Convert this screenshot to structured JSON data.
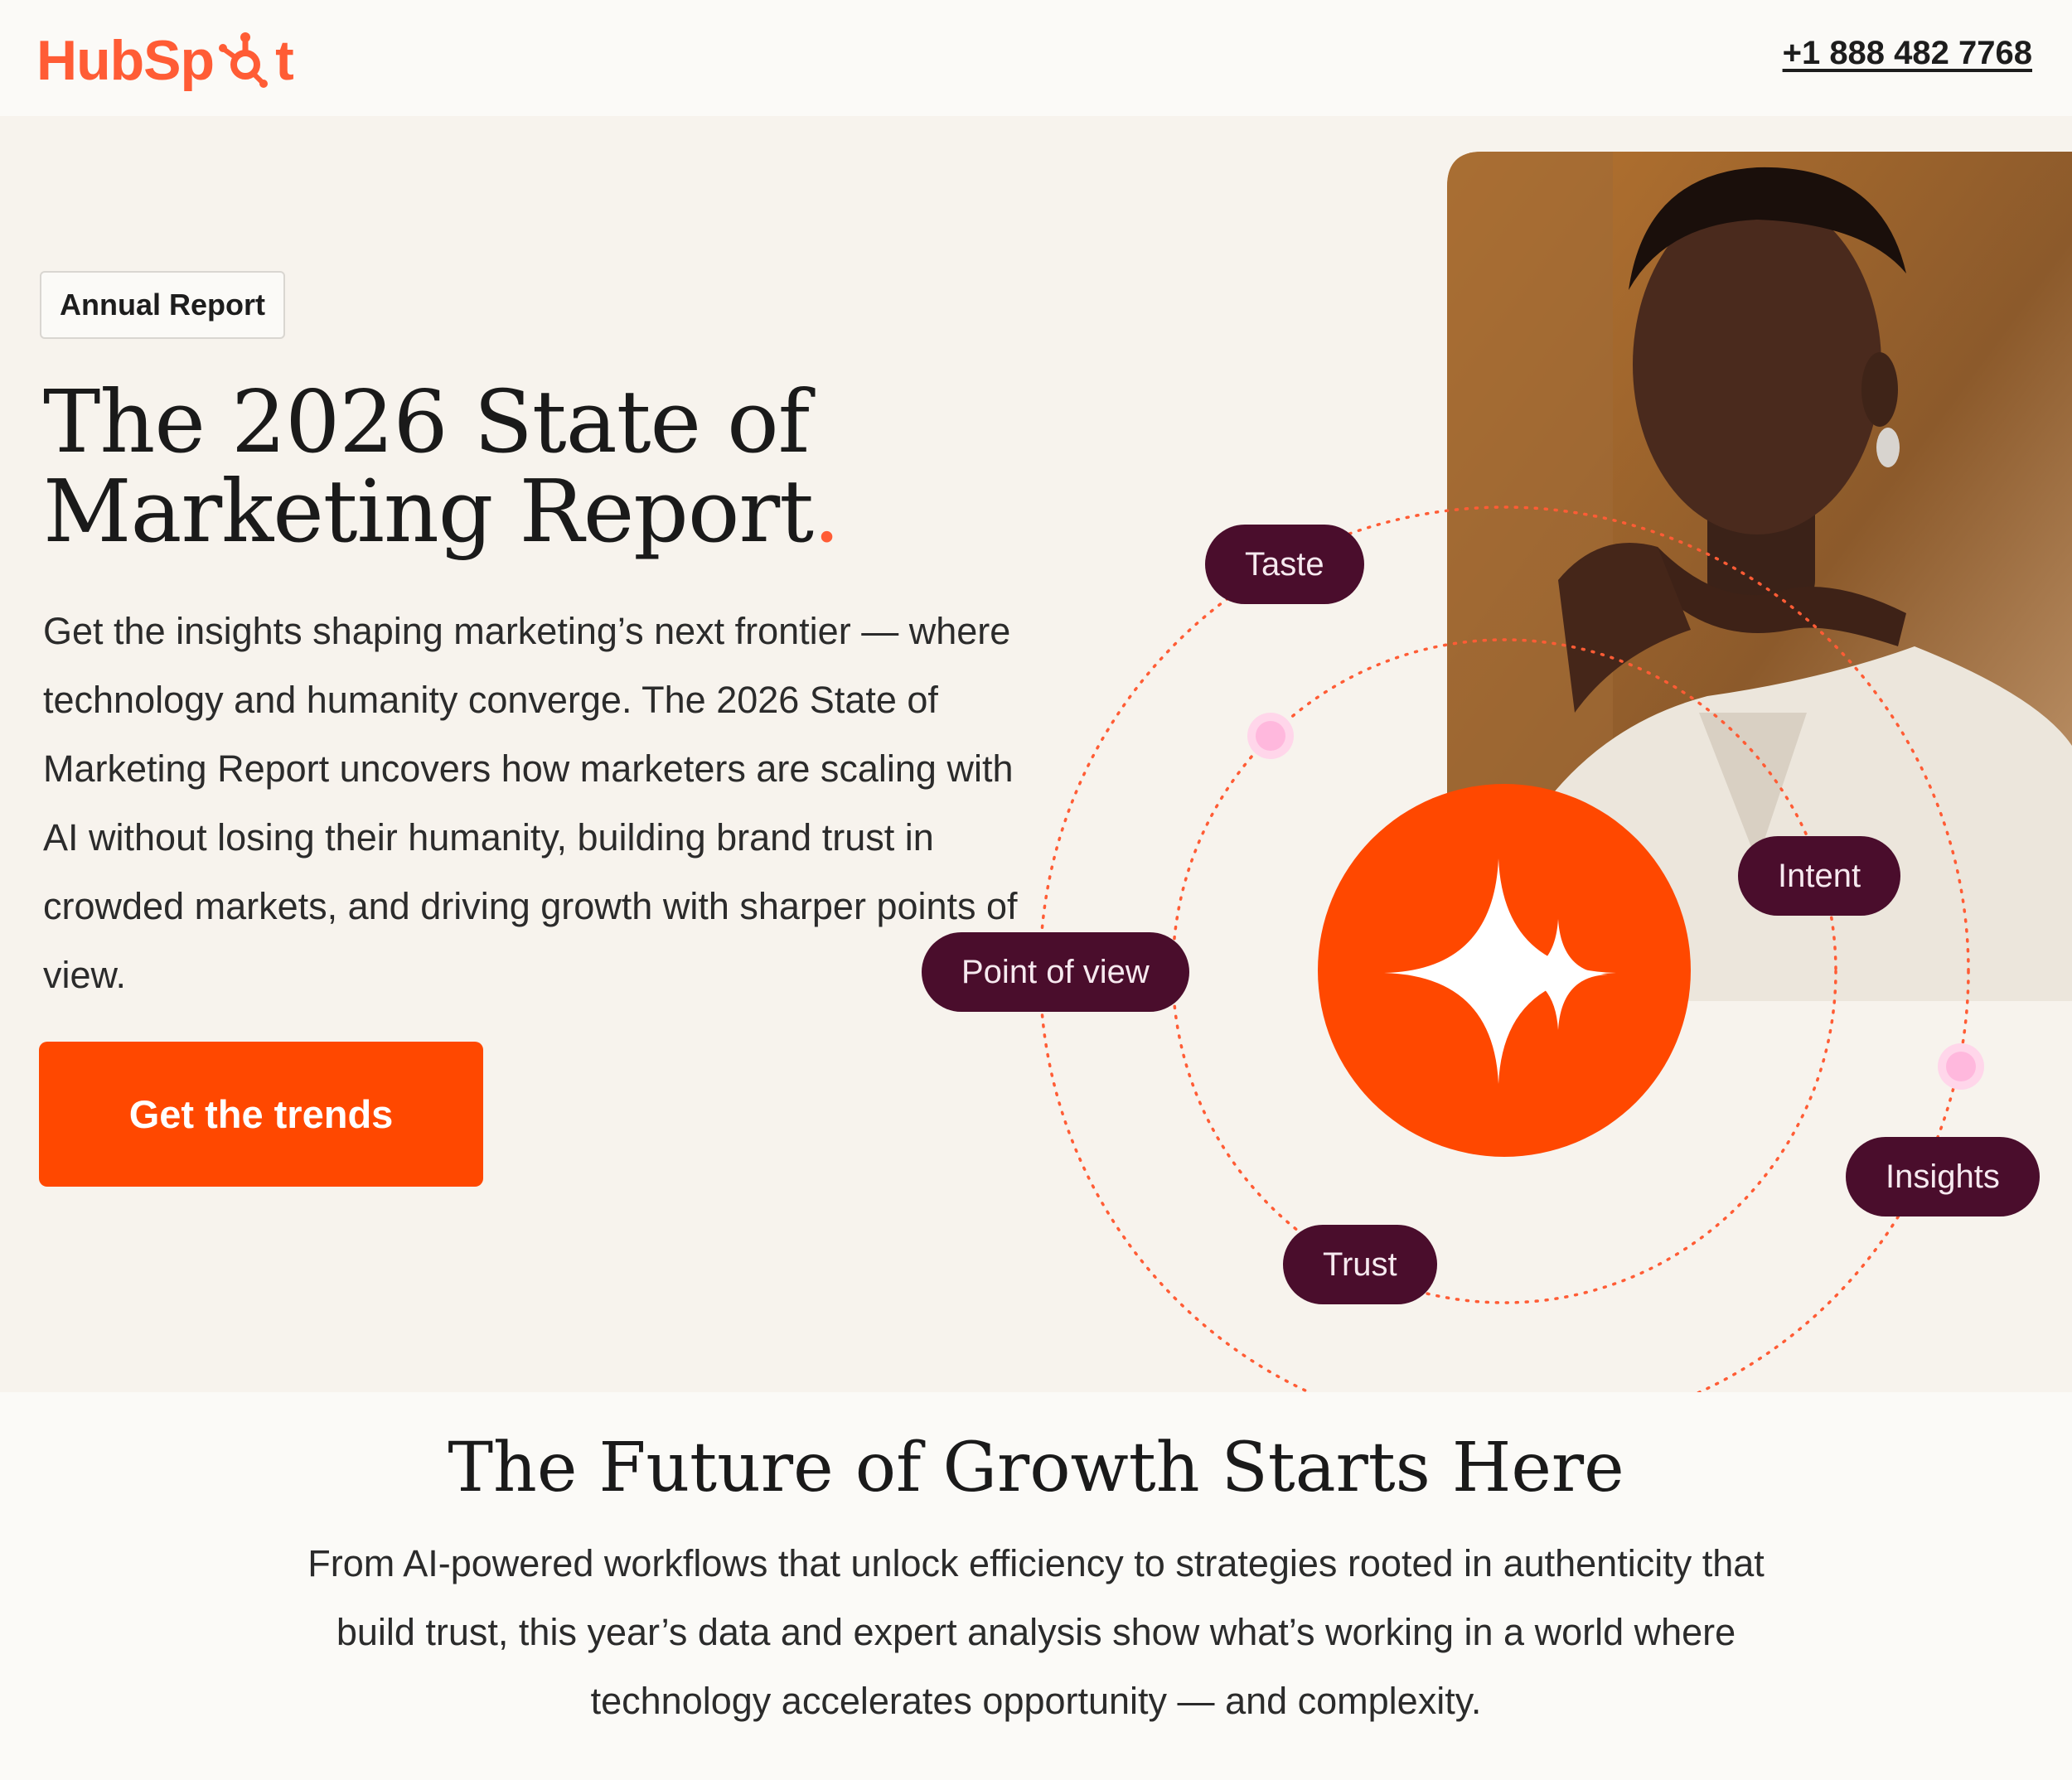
{
  "header": {
    "logo_text_pre": "HubSp",
    "logo_text_post": "t",
    "phone": "+1 888 482 7768"
  },
  "hero": {
    "badge": "Annual Report",
    "title_line1": "The 2026 State of",
    "title_line2": "Marketing Report",
    "title_dot": ".",
    "description": "Get the insights shaping marketing’s next frontier — where technology and humanity converge. The 2026 State of Marketing Report uncovers how marketers are scaling with AI without losing their humanity, building brand trust in crowded markets, and driving growth with sharper points of view.",
    "cta_label": "Get the trends",
    "pills": {
      "taste": "Taste",
      "intent": "Intent",
      "point_of_view": "Point of view",
      "insights": "Insights",
      "trust": "Trust"
    },
    "center_icon": "sparkle-icon"
  },
  "section": {
    "title": "The Future of Growth Starts Here",
    "body": "From AI-powered workflows that unlock efficiency to strategies rooted in authenticity that build trust, this year’s data and expert analysis show what’s working in a world where technology accelerates opportunity — and complexity."
  },
  "colors": {
    "brand_orange": "#ff5c35",
    "cta_orange": "#ff4800",
    "pill_purple": "#4a0d2c",
    "hero_bg": "#f7f3ed",
    "pink_dot": "#ffb8dd"
  }
}
